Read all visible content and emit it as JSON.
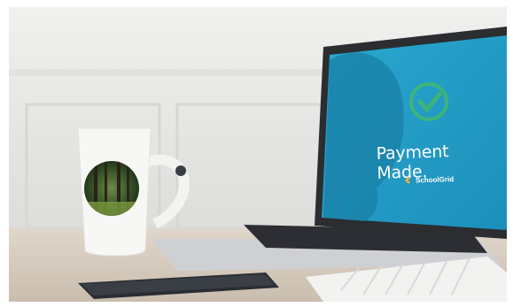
{
  "scene": {
    "screen": {
      "headline": "Payment Made.",
      "brand_name": "SchoolGrid",
      "check_icon": "check-circle-icon",
      "accent_color": "#3fb47a",
      "screen_color": "#1f9ec8"
    },
    "colors": {
      "wall": "#e9e9e7",
      "table": "#d8cdbf",
      "mug": "#f7f7f5",
      "laptop_body": "#d9dadc",
      "phone": "#2a2d32"
    }
  }
}
